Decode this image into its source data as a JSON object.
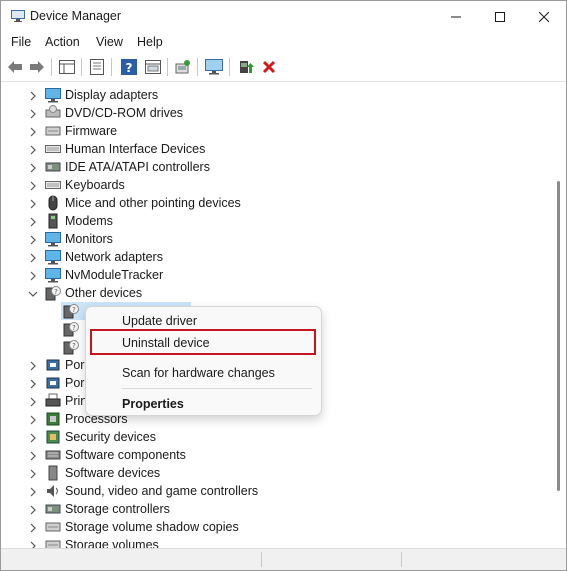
{
  "window": {
    "title": "Device Manager"
  },
  "menu": [
    "File",
    "Action",
    "View",
    "Help"
  ],
  "toolbar": {
    "buttons": [
      "back-arrow-icon",
      "forward-arrow-icon",
      "properties-pane-icon",
      "list-view-icon",
      "help-icon",
      "device-view-icon",
      "scan-hardware-icon",
      "monitor-icon",
      "update-driver-icon",
      "uninstall-device-icon"
    ],
    "accent_uninstall": "#d01a1a"
  },
  "tree": {
    "nodes": [
      {
        "label": "Display adapters",
        "icon": "display-adapter-icon",
        "expanded": false
      },
      {
        "label": "DVD/CD-ROM drives",
        "icon": "dvd-drive-icon",
        "expanded": false
      },
      {
        "label": "Firmware",
        "icon": "firmware-icon",
        "expanded": false
      },
      {
        "label": "Human Interface Devices",
        "icon": "hid-icon",
        "expanded": false
      },
      {
        "label": "IDE ATA/ATAPI controllers",
        "icon": "ide-controller-icon",
        "expanded": false
      },
      {
        "label": "Keyboards",
        "icon": "keyboard-icon",
        "expanded": false
      },
      {
        "label": "Mice and other pointing devices",
        "icon": "mouse-icon",
        "expanded": false
      },
      {
        "label": "Modems",
        "icon": "modem-icon",
        "expanded": false
      },
      {
        "label": "Monitors",
        "icon": "monitor-icon",
        "expanded": false
      },
      {
        "label": "Network adapters",
        "icon": "network-adapter-icon",
        "expanded": false
      },
      {
        "label": "NvModuleTracker",
        "icon": "nvmodule-icon",
        "expanded": false
      },
      {
        "label": "Other devices",
        "icon": "unknown-device-icon",
        "expanded": true
      },
      {
        "label": "Por",
        "icon": "port-icon",
        "expanded": false
      },
      {
        "label": "Por",
        "icon": "port-icon",
        "expanded": false
      },
      {
        "label": "Prin",
        "icon": "printer-icon",
        "expanded": false
      },
      {
        "label": "Processors",
        "icon": "processor-icon",
        "expanded": false
      },
      {
        "label": "Security devices",
        "icon": "security-device-icon",
        "expanded": false
      },
      {
        "label": "Software components",
        "icon": "software-component-icon",
        "expanded": false
      },
      {
        "label": "Software devices",
        "icon": "software-device-icon",
        "expanded": false
      },
      {
        "label": "Sound, video and game controllers",
        "icon": "sound-icon",
        "expanded": false
      },
      {
        "label": "Storage controllers",
        "icon": "storage-controller-icon",
        "expanded": false
      },
      {
        "label": "Storage volume shadow copies",
        "icon": "storage-shadow-icon",
        "expanded": false
      },
      {
        "label": "Storage volumes",
        "icon": "storage-volume-icon",
        "expanded": false
      }
    ],
    "other_devices_children": [
      "unknown-device-icon",
      "unknown-device-icon",
      "unknown-device-icon"
    ]
  },
  "context_menu": {
    "items": [
      {
        "label": "Update driver",
        "bold": false
      },
      {
        "label": "Uninstall device",
        "bold": false,
        "highlighted": true
      },
      {
        "label": "Scan for hardware changes",
        "bold": false
      },
      {
        "label": "Properties",
        "bold": true
      }
    ],
    "highlight_color": "#c4161c"
  }
}
